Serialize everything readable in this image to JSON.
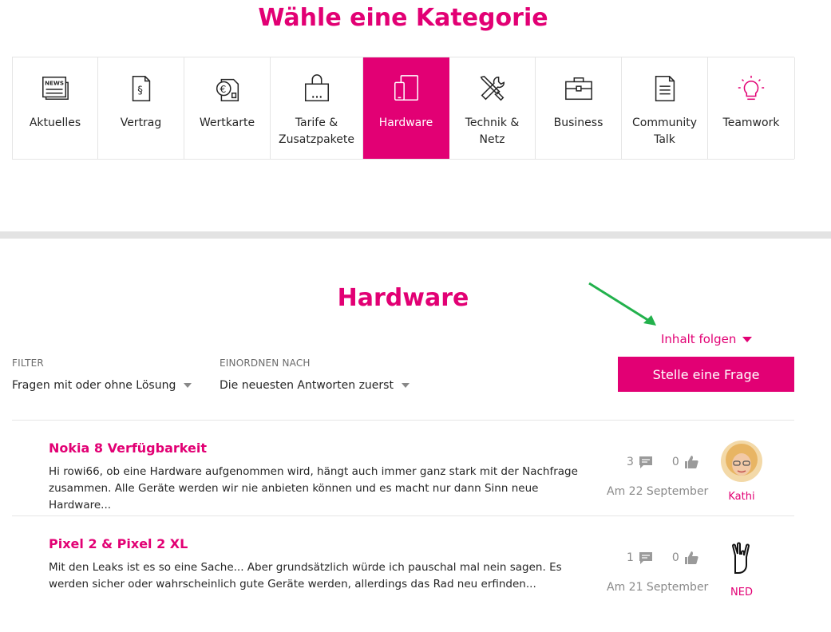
{
  "category_heading": "Wähle eine Kategorie",
  "categories": [
    {
      "label": "Aktuelles",
      "icon": "news-icon"
    },
    {
      "label": "Vertrag",
      "icon": "contract-icon"
    },
    {
      "label": "Wertkarte",
      "icon": "prepaid-card-icon"
    },
    {
      "label": "Tarife & Zusatzpakete",
      "icon": "shopping-bag-icon"
    },
    {
      "label": "Hardware",
      "icon": "devices-icon",
      "active": true
    },
    {
      "label": "Technik & Netz",
      "icon": "tools-icon"
    },
    {
      "label": "Business",
      "icon": "briefcase-icon"
    },
    {
      "label": "Community Talk",
      "icon": "document-icon"
    },
    {
      "label": "Teamwork",
      "icon": "lightbulb-icon"
    }
  ],
  "section_title": "Hardware",
  "follow_label": "Inhalt folgen",
  "filter": {
    "label": "FILTER",
    "value": "Fragen mit oder ohne Lösung"
  },
  "sort": {
    "label": "EINORDNEN NACH",
    "value": "Die neuesten Antworten zuerst"
  },
  "ask_button": "Stelle eine Frage",
  "posts": [
    {
      "title": "Nokia 8 Verfügbarkeit",
      "excerpt": "Hi rowi66, ob eine Hardware aufgenommen wird, hängt auch immer ganz stark mit der Nachfrage zusammen. Alle Geräte werden wir nie anbieten können und es macht nur dann Sinn neue Hardware...",
      "replies": "3",
      "likes": "0",
      "date": "Am 22 September",
      "author": "Kathi"
    },
    {
      "title": "Pixel 2 & Pixel 2 XL",
      "excerpt": "Mit den Leaks ist es so eine Sache...  Aber grundsätzlich würde ich pauschal mal nein sagen. Es werden sicher oder wahrscheinlich gute Geräte werden, allerdings das Rad neu erfinden...",
      "replies": "1",
      "likes": "0",
      "date": "Am 21 September",
      "author": "NED"
    }
  ],
  "colors": {
    "brand": "#e20074",
    "arrow": "#22b14c"
  }
}
